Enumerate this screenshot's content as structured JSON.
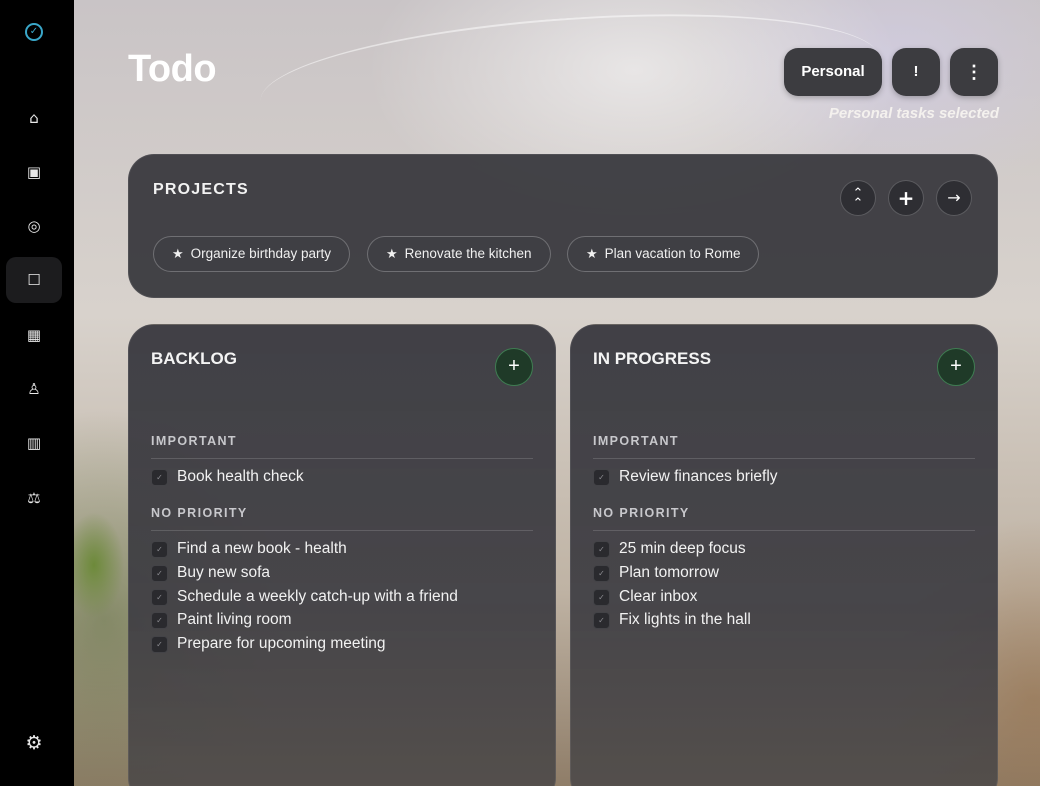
{
  "app": {
    "title": "Todo"
  },
  "sidebar": {
    "logo_icon": "app-logo-icon",
    "items": [
      {
        "icon": "home-icon",
        "glyph": "⌂"
      },
      {
        "icon": "inbox-icon",
        "glyph": "▣"
      },
      {
        "icon": "target-icon",
        "glyph": "◎"
      },
      {
        "icon": "todo-icon",
        "glyph": "☐",
        "active": true
      },
      {
        "icon": "calendar-icon",
        "glyph": "▦"
      },
      {
        "icon": "meditation-icon",
        "glyph": "♙"
      },
      {
        "icon": "calculator-icon",
        "glyph": "▥"
      },
      {
        "icon": "balance-icon",
        "glyph": "⚖"
      }
    ],
    "settings_glyph": "⚙"
  },
  "header": {
    "mode_label": "Personal",
    "priority_label": "!",
    "more_glyph": "⋮",
    "subtitle": "Personal tasks selected"
  },
  "projects": {
    "title": "PROJECTS",
    "collapse_glyph": "⌃",
    "add_glyph": "+",
    "next_glyph": "→",
    "chips": [
      {
        "star": "★",
        "label": "Organize birthday party"
      },
      {
        "star": "★",
        "label": "Renovate the kitchen"
      },
      {
        "star": "★",
        "label": "Plan vacation to Rome"
      }
    ]
  },
  "columns": [
    {
      "title": "BACKLOG",
      "add_glyph": "+",
      "important_label": "IMPORTANT",
      "important": [
        "Book health check"
      ],
      "no_priority_label": "NO PRIORITY",
      "no_priority": [
        "Find a new book - health",
        "Buy new sofa",
        "Schedule a weekly catch-up with a friend",
        "Paint living room",
        "Prepare for upcoming meeting"
      ]
    },
    {
      "title": "IN PROGRESS",
      "add_glyph": "+",
      "important_label": "IMPORTANT",
      "important": [
        "Review finances briefly"
      ],
      "no_priority_label": "NO PRIORITY",
      "no_priority": [
        "25 min deep focus",
        "Plan tomorrow",
        "Clear inbox",
        "Fix lights in the hall"
      ]
    }
  ],
  "check_glyph": "✓"
}
